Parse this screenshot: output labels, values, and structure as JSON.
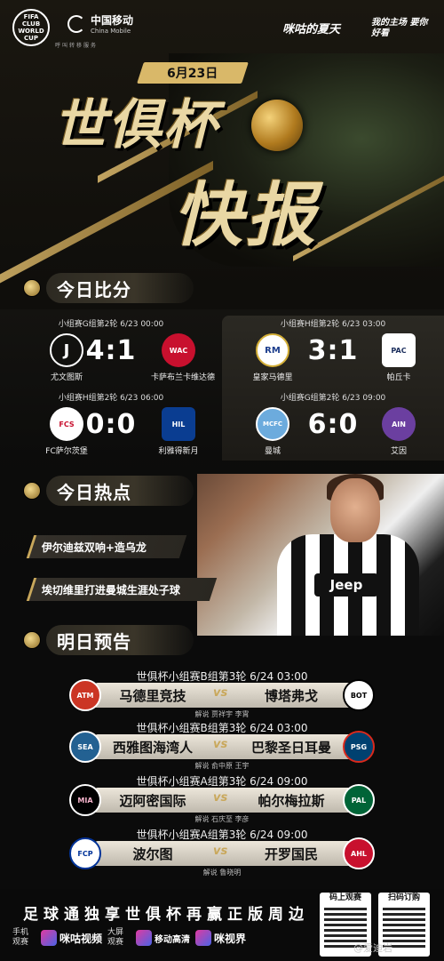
{
  "header": {
    "fifa_logo_text": "FIFA CLUB WORLD CUP",
    "cm_cn": "中国移动",
    "cm_en": "China Mobile",
    "cm_sub": "呼叫转移服务",
    "brand1": "咪咕的夏天",
    "brand2": "我的主场 要你好看"
  },
  "hero": {
    "date": "6月23日",
    "title1": "世俱杯",
    "title2": "快报"
  },
  "sections": {
    "scores": "今日比分",
    "hot": "今日热点",
    "preview": "明日预告"
  },
  "scores": [
    {
      "meta": "小组赛G组第2轮  6/23  00:00",
      "score": "4:1",
      "home": "尤文图斯",
      "away": "卡萨布兰卡维达德",
      "home_crest": "J",
      "away_crest": "WAC"
    },
    {
      "meta": "小组赛H组第2轮  6/23  03:00",
      "score": "3:1",
      "home": "皇家马德里",
      "away": "帕丘卡",
      "home_crest": "RM",
      "away_crest": "PAC"
    },
    {
      "meta": "小组赛H组第2轮  6/23  06:00",
      "score": "0:0",
      "home": "FC萨尔茨堡",
      "away": "利雅得新月",
      "home_crest": "FCS",
      "away_crest": "HIL"
    },
    {
      "meta": "小组赛G组第2轮  6/23  09:00",
      "score": "6:0",
      "home": "曼城",
      "away": "艾因",
      "home_crest": "MCFC",
      "away_crest": "AIN"
    }
  ],
  "hot": [
    "伊尔迪兹双响+造乌龙",
    "埃切维里打进曼城生涯处子球"
  ],
  "player": {
    "sponsor": "Jeep"
  },
  "preview": [
    {
      "head": "世俱杯小组赛B组第3轮    6/24    03:00",
      "home": "马德里竞技",
      "away": "博塔弗戈",
      "comm": "解说  贾祥宇  李霄",
      "home_crest": "ATM",
      "away_crest": "BOT"
    },
    {
      "head": "世俱杯小组赛B组第3轮    6/24    03:00",
      "home": "西雅图海湾人",
      "away": "巴黎圣日耳曼",
      "comm": "解说  俞中原  王宇",
      "home_crest": "SEA",
      "away_crest": "PSG"
    },
    {
      "head": "世俱杯小组赛A组第3轮    6/24    09:00",
      "home": "迈阿密国际",
      "away": "帕尔梅拉斯",
      "comm": "解说  石庆至  李彦",
      "home_crest": "MIA",
      "away_crest": "PAL"
    },
    {
      "head": "世俱杯小组赛A组第3轮    6/24    09:00",
      "home": "波尔图",
      "away": "开罗国民",
      "comm": "解说  鲁晓明",
      "home_crest": "FCP",
      "away_crest": "AHL"
    }
  ],
  "vs_label": "vs",
  "footer": {
    "slogan": "足球通独享世俱杯再赢正版周边",
    "phone_label": "手机观赛",
    "tv_label": "大屏观赛",
    "app1": "咪咕视频",
    "app2": "移动高清",
    "app3": "咪视界",
    "qr1": "码上观赛",
    "qr2": "扫码订购",
    "watermark": "@爱迪岩"
  }
}
